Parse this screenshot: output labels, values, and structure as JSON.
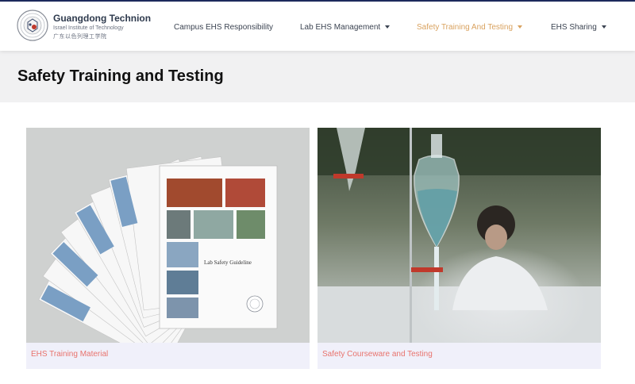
{
  "header": {
    "logo_en": "Guangdong Technion",
    "logo_sub": "Israel Institute of Technology",
    "logo_cn": "广东以色列理工学院"
  },
  "nav": [
    {
      "label": "Campus EHS Responsibility",
      "has_dropdown": false,
      "active": false
    },
    {
      "label": "Lab EHS Management",
      "has_dropdown": true,
      "active": false
    },
    {
      "label": "Safety Training And Testing",
      "has_dropdown": true,
      "active": true
    },
    {
      "label": "EHS Sharing",
      "has_dropdown": true,
      "active": false
    }
  ],
  "page": {
    "title": "Safety Training and Testing"
  },
  "cards": [
    {
      "label": "EHS Training Material",
      "booklet_title": "Lab Safety Guideline"
    },
    {
      "label": "Safety Courseware and Testing"
    }
  ],
  "colors": {
    "accent": "#d9a25f",
    "card_label": "#e8736d",
    "topline": "#1d2a5c",
    "title_band": "#f1f1f2",
    "card_bg": "#f0f0fa"
  }
}
